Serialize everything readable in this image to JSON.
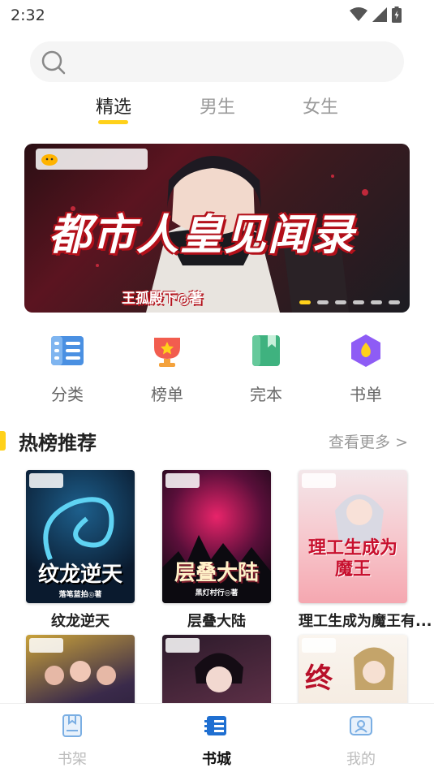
{
  "status_bar": {
    "time": "2:32",
    "icons": [
      "wifi-icon",
      "signal-icon",
      "battery-icon"
    ]
  },
  "search": {
    "placeholder": ""
  },
  "tabs": [
    {
      "label": "精选",
      "active": true
    },
    {
      "label": "男生",
      "active": false
    },
    {
      "label": "女生",
      "active": false
    }
  ],
  "banner": {
    "title": "都市人皇见闻录",
    "author": "王孤殿下◎著",
    "dots": 6,
    "active_dot": 0
  },
  "categories": [
    {
      "label": "分类",
      "icon": "category-list-icon"
    },
    {
      "label": "榜单",
      "icon": "trophy-icon"
    },
    {
      "label": "完本",
      "icon": "bookmark-book-icon"
    },
    {
      "label": "书单",
      "icon": "booklist-badge-icon"
    }
  ],
  "section": {
    "title": "热榜推荐",
    "more": "查看更多 >"
  },
  "books": [
    {
      "title": "纹龙逆天",
      "cover_text": "纹龙逆天",
      "cover_author": "落笔蓝拍◎著"
    },
    {
      "title": "层叠大陆",
      "cover_text": "层叠大陆",
      "cover_author": "黑灯村行◎著"
    },
    {
      "title": "理工生成为魔王有...",
      "cover_text": "理工生成为魔王",
      "cover_author": ""
    },
    {
      "title": "",
      "cover_text": "",
      "cover_author": ""
    },
    {
      "title": "",
      "cover_text": "",
      "cover_author": ""
    },
    {
      "title": "",
      "cover_text": "终",
      "cover_author": ""
    }
  ],
  "bottom_nav": [
    {
      "label": "书架",
      "icon": "bookshelf-icon",
      "active": false
    },
    {
      "label": "书城",
      "icon": "bookstore-icon",
      "active": true
    },
    {
      "label": "我的",
      "icon": "profile-icon",
      "active": false
    }
  ],
  "colors": {
    "accent": "#ffd11a",
    "inactive_text": "#9a9a9a",
    "nav_inactive": "#bdbdbd",
    "icon_blue": "#4a90e2"
  }
}
